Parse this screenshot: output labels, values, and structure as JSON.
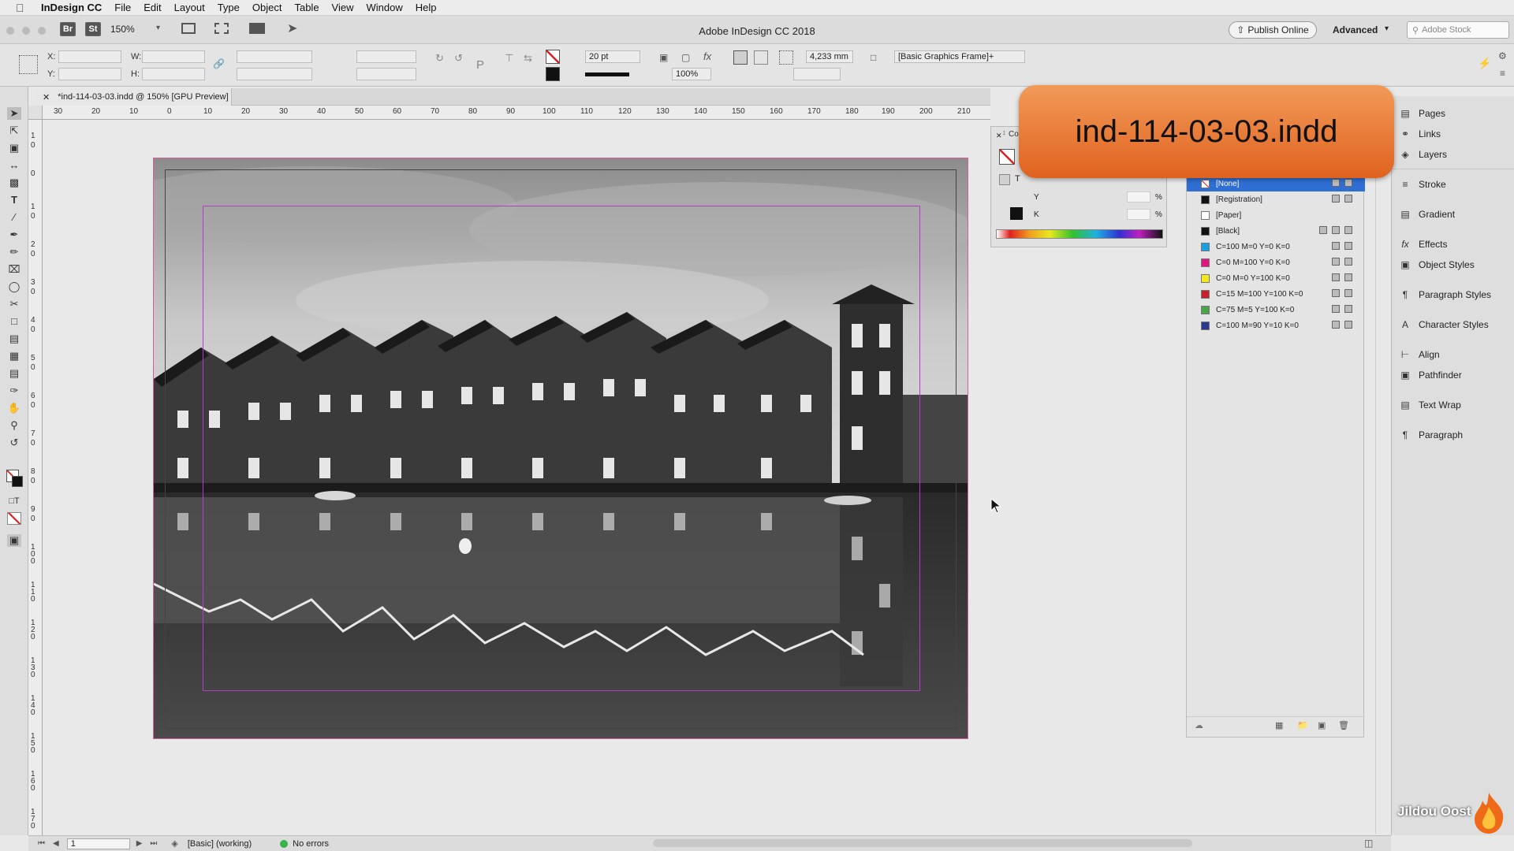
{
  "menubar": {
    "app": "InDesign CC",
    "items": [
      "File",
      "Edit",
      "Layout",
      "Type",
      "Object",
      "Table",
      "View",
      "Window",
      "Help"
    ]
  },
  "titlebar": {
    "br_label": "Br",
    "st_label": "St",
    "zoom": "150%",
    "title": "Adobe InDesign CC 2018",
    "publish": "Publish Online",
    "workspace": "Advanced",
    "stock_placeholder": "Adobe Stock"
  },
  "control": {
    "x_label": "X:",
    "y_label": "Y:",
    "w_label": "W:",
    "h_label": "H:",
    "stroke_weight": "20 pt",
    "scale": "100%",
    "dimension": "4,233 mm",
    "frame_style": "[Basic Graphics Frame]+"
  },
  "document": {
    "tab_title": "*ind-114-03-03.indd @ 150% [GPU Preview]",
    "banner": "ind-114-03-03.indd"
  },
  "ruler_h": [
    "30",
    "20",
    "10",
    "0",
    "10",
    "20",
    "30",
    "40",
    "50",
    "60",
    "70",
    "80",
    "90",
    "100",
    "110",
    "120",
    "130",
    "140",
    "150",
    "160",
    "170",
    "180",
    "190",
    "200",
    "210"
  ],
  "ruler_v": [
    "1",
    "0",
    "0",
    "1",
    "0",
    "2",
    "0",
    "3",
    "0",
    "4",
    "0",
    "5",
    "0",
    "6",
    "0",
    "7",
    "0",
    "8",
    "0",
    "9",
    "0",
    "100",
    "110",
    "120",
    "130",
    "140",
    "150",
    "160",
    "170"
  ],
  "color_panel": {
    "title": "Col",
    "y_label": "Y",
    "k_label": "K",
    "percent": "%"
  },
  "swatches": [
    {
      "name": "[None]",
      "color": "#ffffff",
      "selected": true
    },
    {
      "name": "[Registration]",
      "color": "#111111",
      "selected": false
    },
    {
      "name": "[Paper]",
      "color": "#ffffff",
      "selected": false
    },
    {
      "name": "[Black]",
      "color": "#111111",
      "selected": false
    },
    {
      "name": "C=100 M=0 Y=0 K=0",
      "color": "#1aa0e0",
      "selected": false
    },
    {
      "name": "C=0 M=100 Y=0 K=0",
      "color": "#e0157f",
      "selected": false
    },
    {
      "name": "C=0 M=0 Y=100 K=0",
      "color": "#f5e81c",
      "selected": false
    },
    {
      "name": "C=15 M=100 Y=100 K=0",
      "color": "#c8202a",
      "selected": false
    },
    {
      "name": "C=75 M=5 Y=100 K=0",
      "color": "#4aa546",
      "selected": false
    },
    {
      "name": "C=100 M=90 Y=10 K=0",
      "color": "#283c8f",
      "selected": false
    }
  ],
  "dock": [
    {
      "label": "Pages",
      "icon": "pages-icon"
    },
    {
      "label": "Links",
      "icon": "links-icon"
    },
    {
      "label": "Layers",
      "icon": "layers-icon"
    },
    {
      "label": "Stroke",
      "icon": "stroke-icon"
    },
    {
      "label": "Gradient",
      "icon": "gradient-icon"
    },
    {
      "label": "Effects",
      "icon": "effects-icon"
    },
    {
      "label": "Object Styles",
      "icon": "object-styles-icon"
    },
    {
      "label": "Paragraph Styles",
      "icon": "paragraph-styles-icon"
    },
    {
      "label": "Character Styles",
      "icon": "character-styles-icon"
    },
    {
      "label": "Align",
      "icon": "align-icon"
    },
    {
      "label": "Pathfinder",
      "icon": "pathfinder-icon"
    },
    {
      "label": "Text Wrap",
      "icon": "text-wrap-icon"
    },
    {
      "label": "Paragraph",
      "icon": "paragraph-icon"
    }
  ],
  "status": {
    "page": "1",
    "profile": "[Basic] (working)",
    "errors": "No errors"
  },
  "watermark": "Jildou Oost"
}
